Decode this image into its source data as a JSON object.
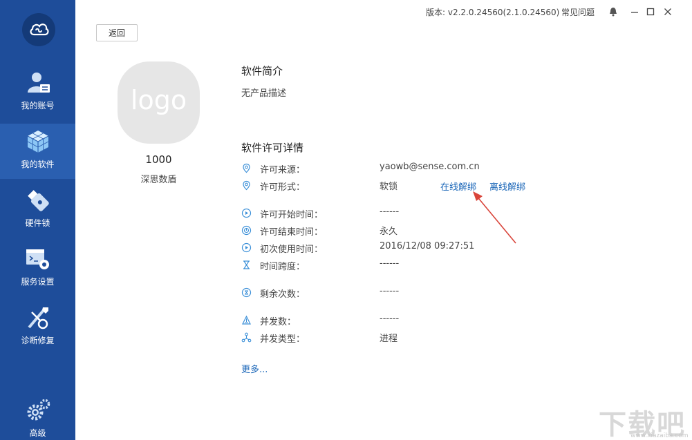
{
  "titlebar": {
    "version": "版本: v2.2.0.24560(2.1.0.24560)",
    "faq": "常见问题"
  },
  "sidebar": {
    "items": [
      {
        "label": "我的账号",
        "icon": "account-icon"
      },
      {
        "label": "我的软件",
        "icon": "software-cube-icon"
      },
      {
        "label": "硬件锁",
        "icon": "usb-dongle-icon"
      },
      {
        "label": "服务设置",
        "icon": "service-settings-icon"
      },
      {
        "label": "诊断修复",
        "icon": "repair-tools-icon"
      },
      {
        "label": "高级",
        "icon": "gears-icon"
      }
    ],
    "active_index": 1
  },
  "back_button": "返回",
  "software": {
    "logo_text": "logo",
    "id": "1000",
    "name": "深思数盾"
  },
  "intro": {
    "title": "软件简介",
    "text": "无产品描述"
  },
  "license": {
    "title": "软件许可详情",
    "rows": [
      {
        "label": "许可来源：",
        "value": "yaowb@sense.com.cn"
      },
      {
        "label": "许可形式：",
        "value": "软锁"
      },
      {
        "label": "许可开始时间：",
        "value": "------"
      },
      {
        "label": "许可结束时间：",
        "value": "永久"
      },
      {
        "label": "初次使用时间：",
        "value": "2016/12/08 09:27:51"
      },
      {
        "label": "时间跨度：",
        "value": "------"
      },
      {
        "label": "剩余次数：",
        "value": "------"
      },
      {
        "label": "并发数：",
        "value": "------"
      },
      {
        "label": "并发类型：",
        "value": "进程"
      }
    ],
    "online_unbind": "在线解绑",
    "offline_unbind": "离线解绑",
    "more": "更多..."
  },
  "watermark": {
    "text": "下载吧",
    "url": "www.xiazaiba.com"
  },
  "colors": {
    "sidebar_bg": "#1e4d9a",
    "sidebar_active": "#2a5fb0",
    "link": "#1a66b8",
    "icon_blue": "#3a8fd8",
    "arrow": "#d9443a"
  }
}
